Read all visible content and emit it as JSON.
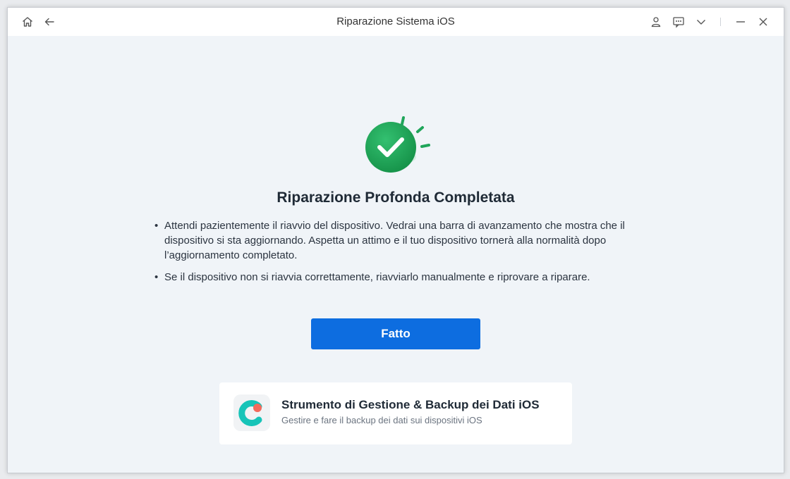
{
  "window": {
    "title": "Riparazione Sistema iOS"
  },
  "titlebar": {
    "icons": [
      "home-icon",
      "back-arrow-icon",
      "user-icon",
      "feedback-icon",
      "chevron-down-icon",
      "minimize-icon",
      "close-icon"
    ]
  },
  "result": {
    "heading": "Riparazione Profonda Completata",
    "bullets": [
      "Attendi pazientemente il riavvio del dispositivo. Vedrai una barra di avanzamento che mostra che il dispositivo si sta aggiornando. Aspetta un attimo e il tuo dispositivo tornerà alla normalità dopo l’aggiornamento completato.",
      "Se il dispositivo non si riavvia correttamente, riavviarlo manualmente e riprovare a riparare."
    ],
    "done_label": "Fatto"
  },
  "promo": {
    "title": "Strumento di Gestione & Backup dei Dati iOS",
    "subtitle": "Gestire e fare il backup dei dati sui dispositivi iOS",
    "icon": "app-logo-icon"
  },
  "colors": {
    "accent": "#0d6de0",
    "success": "#1fa55a",
    "background": "#f0f4f8"
  }
}
